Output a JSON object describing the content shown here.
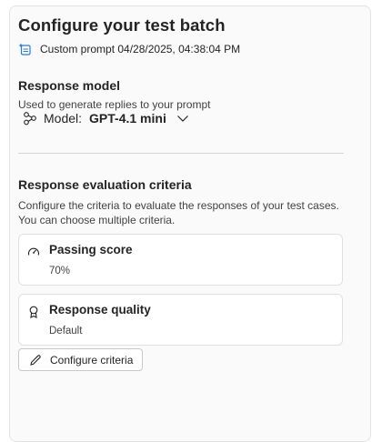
{
  "panel": {
    "title": "Configure your test batch",
    "prompt_label": "Custom prompt 04/28/2025, 04:38:04 PM",
    "prompt_icon": "custom-prompt-icon"
  },
  "response_model": {
    "heading": "Response model",
    "description": "Used to generate replies to your prompt",
    "model_label": "Model:",
    "model_value": "GPT-4.1 mini",
    "model_icon": "model-nodes-icon",
    "dropdown_icon": "chevron-down-icon"
  },
  "evaluation": {
    "heading": "Response evaluation criteria",
    "description_line1": "Configure the criteria to evaluate the responses of your test cases.",
    "description_line2": "You can choose multiple criteria.",
    "criteria": [
      {
        "title": "Passing score",
        "value": "70%",
        "icon": "gauge-icon"
      },
      {
        "title": "Response quality",
        "value": "Default",
        "icon": "ribbon-icon"
      }
    ],
    "configure_button_label": "Configure criteria",
    "configure_button_icon": "pencil-icon"
  },
  "colors": {
    "panel_bg": "#fafafa",
    "card_bg": "#ffffff",
    "text": "#242424",
    "accent_blue": "#2b7cd3"
  }
}
